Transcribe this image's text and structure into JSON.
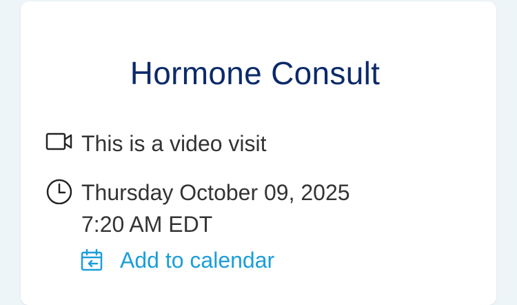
{
  "appointment": {
    "title": "Hormone Consult",
    "visit_type": "This is a video visit",
    "date": "Thursday October 09, 2025",
    "time": "7:20 AM EDT",
    "calendar_link": "Add to calendar"
  },
  "icons": {
    "visit": "video-camera-icon",
    "time": "clock-icon",
    "calendar": "calendar-add-icon"
  },
  "colors": {
    "title": "#0b2a6b",
    "link": "#1a9ed9",
    "text": "#333333"
  }
}
